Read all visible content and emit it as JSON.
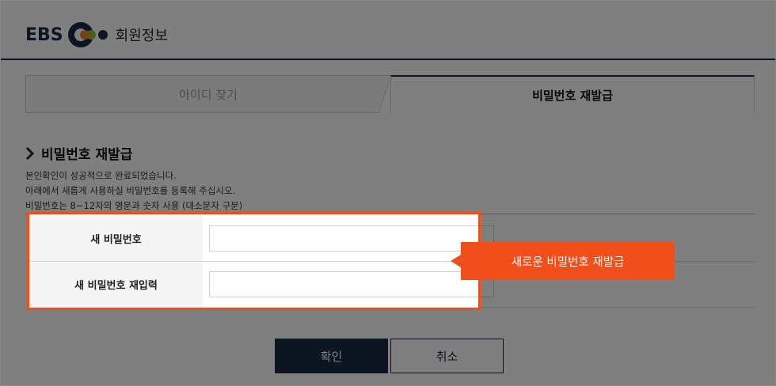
{
  "header": {
    "brand": "EBS",
    "title": "회원정보"
  },
  "tabs": [
    {
      "label": "아이디 찾기",
      "active": false
    },
    {
      "label": "비밀번호 재발급",
      "active": true
    }
  ],
  "section": {
    "title": "비밀번호 재발급",
    "desc": [
      "본인확인이 성공적으로 완료되었습니다.",
      "아래에서 새롭게 사용하실 비밀번호를 등록해 주십시오.",
      "비밀번호는 8~12자의 영문과 숫자 사용 (대소문자 구분)"
    ]
  },
  "form": {
    "new_password": {
      "label": "새 비밀번호",
      "value": "",
      "placeholder": ""
    },
    "confirm_password": {
      "label": "새 비밀번호 재입력",
      "value": "",
      "placeholder": ""
    }
  },
  "callout": "새로운 비밀번호 재발급",
  "buttons": {
    "confirm": "확인",
    "cancel": "취소"
  },
  "colors": {
    "navy": "#1b2a45",
    "highlight": "#f04e1b",
    "logo_orange": "#e8872a",
    "logo_green": "#8fbf3a"
  }
}
